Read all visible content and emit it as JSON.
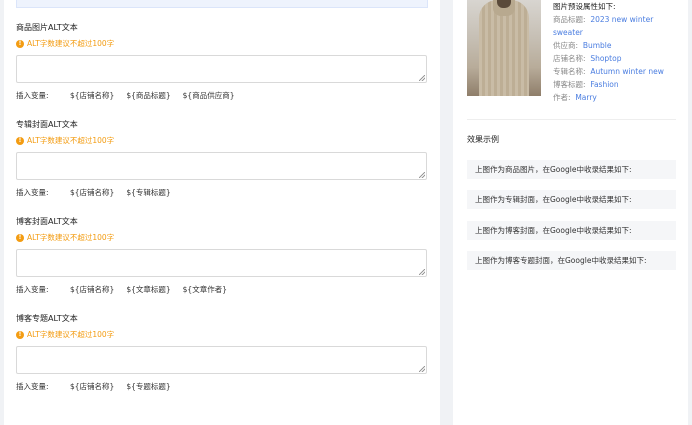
{
  "sections": [
    {
      "title": "商品图片ALT文本",
      "tip": "ALT字数建议不超过100字",
      "vars_label": "插入变量:",
      "vars": [
        "${店铺名称}",
        "${商品标题}",
        "${商品供应商}"
      ]
    },
    {
      "title": "专辑封面ALT文本",
      "tip": "ALT字数建议不超过100字",
      "vars_label": "插入变量:",
      "vars": [
        "${店铺名称}",
        "${专辑标题}"
      ]
    },
    {
      "title": "博客封面ALT文本",
      "tip": "ALT字数建议不超过100字",
      "vars_label": "插入变量:",
      "vars": [
        "${店铺名称}",
        "${文章标题}",
        "${文章作者}"
      ]
    },
    {
      "title": "博客专题ALT文本",
      "tip": "ALT字数建议不超过100字",
      "vars_label": "插入变量:",
      "vars": [
        "${店铺名称}",
        "${专题标题}"
      ]
    }
  ],
  "preview": {
    "heading": "图片预设属性如下:",
    "attrs": [
      {
        "key": "商品标题:",
        "value": "2023 new winter sweater"
      },
      {
        "key": "供应商:",
        "value": "Bumble"
      },
      {
        "key": "店铺名称:",
        "value": "Shoptop"
      },
      {
        "key": "专辑名称:",
        "value": "Autumn winter new"
      },
      {
        "key": "博客标题:",
        "value": "Fashion"
      },
      {
        "key": "作者:",
        "value": "Marry"
      }
    ]
  },
  "examples": {
    "title": "效果示例",
    "items": [
      "上图作为商品图片，在Google中收录结果如下:",
      "上图作为专辑封面，在Google中收录结果如下:",
      "上图作为博客封面，在Google中收录结果如下:",
      "上图作为博客专题封面，在Google中收录结果如下:"
    ]
  },
  "colors": {
    "tip": "#f39c12",
    "link": "#4a7de0"
  },
  "icons": {
    "tip": "warning-circle-icon"
  }
}
